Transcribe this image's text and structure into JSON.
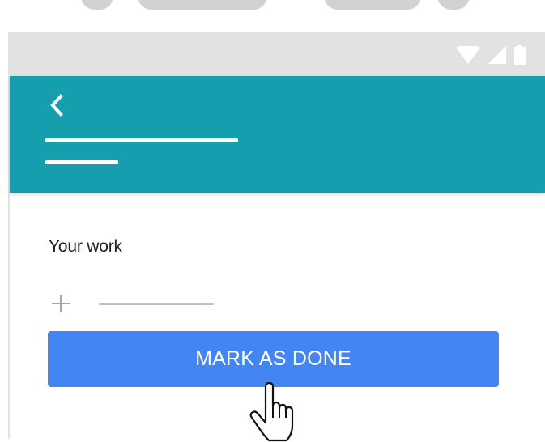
{
  "status_bar": {
    "icons": [
      "wifi-icon",
      "signal-icon",
      "battery-icon"
    ]
  },
  "app_bar": {
    "back_icon": "chevron-left-icon"
  },
  "content": {
    "section_title": "Your work",
    "add_icon": "plus-icon",
    "primary_button_label": "MARK AS DONE"
  },
  "overlay": {
    "cursor_icon": "hand-pointer-icon"
  },
  "colors": {
    "status_bar": "#e2e2e2",
    "app_bar": "#159eae",
    "primary_button": "#4485f4",
    "text": "#222222",
    "placeholder_line": "#bfbfbf"
  }
}
